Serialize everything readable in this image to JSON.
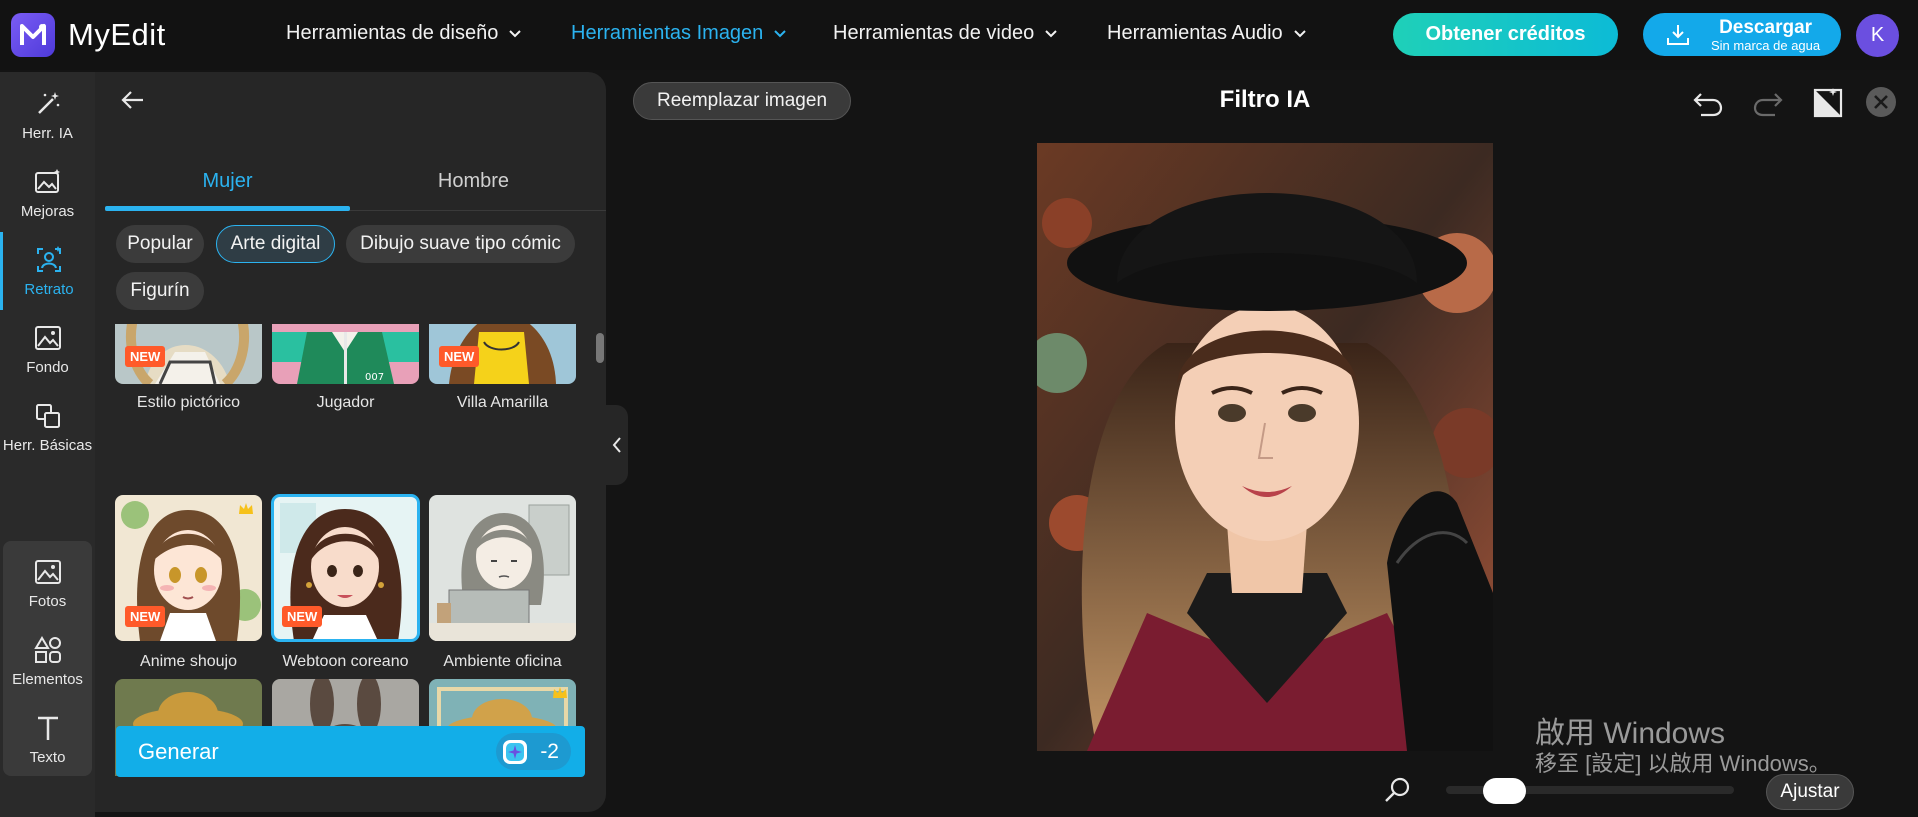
{
  "app": {
    "name": "MyEdit"
  },
  "nav": [
    {
      "label": "Herramientas de diseño",
      "active": false
    },
    {
      "label": "Herramientas Imagen",
      "active": true
    },
    {
      "label": "Herramientas de video",
      "active": false
    },
    {
      "label": "Herramientas Audio",
      "active": false
    }
  ],
  "header": {
    "credits_label": "Obtener créditos",
    "download_label": "Descargar",
    "download_sub": "Sin marca de agua",
    "avatar_initial": "K"
  },
  "rail": [
    {
      "label": "Herr. IA",
      "icon": "magic-wand-icon"
    },
    {
      "label": "Mejoras",
      "icon": "image-enhance-icon"
    },
    {
      "label": "Retrato",
      "icon": "portrait-icon",
      "active": true
    },
    {
      "label": "Fondo",
      "icon": "background-icon"
    },
    {
      "label": "Herr. Básicas",
      "icon": "basic-tools-icon"
    },
    {
      "label": "Fotos",
      "icon": "photos-icon"
    },
    {
      "label": "Elementos",
      "icon": "elements-icon"
    },
    {
      "label": "Texto",
      "icon": "text-icon"
    }
  ],
  "panel": {
    "tabs": [
      {
        "label": "Mujer",
        "active": true
      },
      {
        "label": "Hombre",
        "active": false
      }
    ],
    "chips": [
      {
        "label": "Popular",
        "active": false
      },
      {
        "label": "Arte digital",
        "active": true
      },
      {
        "label": "Dibujo suave tipo cómic",
        "active": false
      },
      {
        "label": "Figurín",
        "active": false
      }
    ],
    "styles": [
      {
        "label": "Estilo pictórico",
        "badge": "NEW"
      },
      {
        "label": "Jugador",
        "badge": ""
      },
      {
        "label": "Villa Amarilla",
        "badge": "NEW"
      },
      {
        "label": "Anime shoujo",
        "badge": "NEW",
        "premium": true
      },
      {
        "label": "Webtoon coreano",
        "badge": "NEW",
        "selected": true
      },
      {
        "label": "Ambiente oficina",
        "badge": ""
      }
    ],
    "generate_label": "Generar",
    "generate_cost": "-2"
  },
  "canvas": {
    "replace_label": "Reemplazar imagen",
    "title": "Filtro IA",
    "fit_label": "Ajustar",
    "zoom_level": 0.15
  },
  "watermark": {
    "line1": "啟用 Windows",
    "line2": "移至 [設定] 以啟用 Windows。"
  },
  "colors": {
    "accent": "#2bb3f0",
    "credits": "#1fd0b8",
    "new_badge": "#ff5a2a"
  }
}
